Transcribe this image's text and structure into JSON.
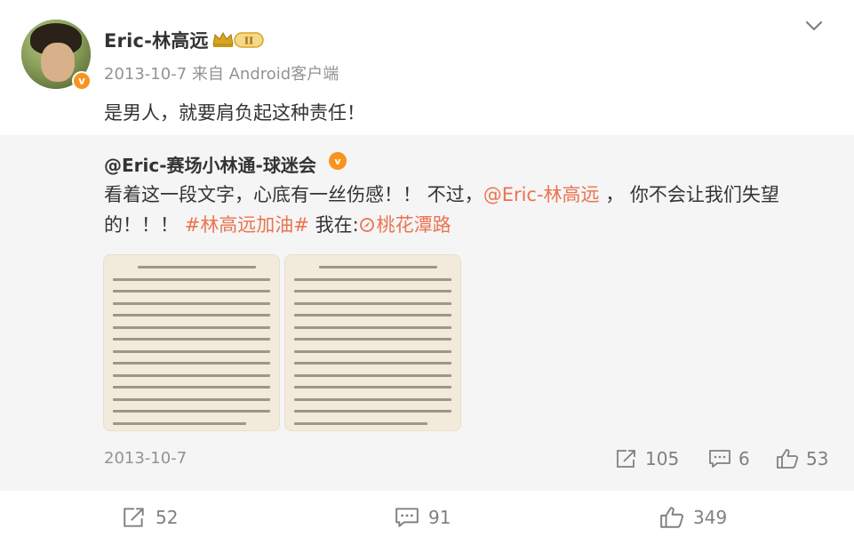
{
  "post": {
    "user_name": "Eric-林高远",
    "vip_level": "II",
    "meta": "2013-10-7 来自 Android客户端",
    "text": "是男人，就要肩负起这种责任！"
  },
  "repost": {
    "author": "@Eric-赛场小林通-球迷会",
    "text_part1": "看着这一段文字，心底有一丝伤感！！ 不过，",
    "mention": "@Eric-林高远",
    "text_part2": " ， 你不会让我们失望的！！！",
    "hashtag": "#林高远加油#",
    "location_prefix": " 我在:",
    "location": "桃花潭路",
    "date": "2013-10-7",
    "repost_count": "105",
    "comment_count": "6",
    "like_count": "53"
  },
  "actions": {
    "repost_count": "52",
    "comment_count": "91",
    "like_count": "349"
  },
  "icons": {
    "chevron": "chevron-down-icon",
    "share": "share-icon",
    "comment": "comment-icon",
    "like": "thumbs-up-icon",
    "location": "location-icon"
  },
  "colors": {
    "link": "#eb7350",
    "verified": "#f7931e",
    "repost_bg": "#f5f5f5"
  }
}
